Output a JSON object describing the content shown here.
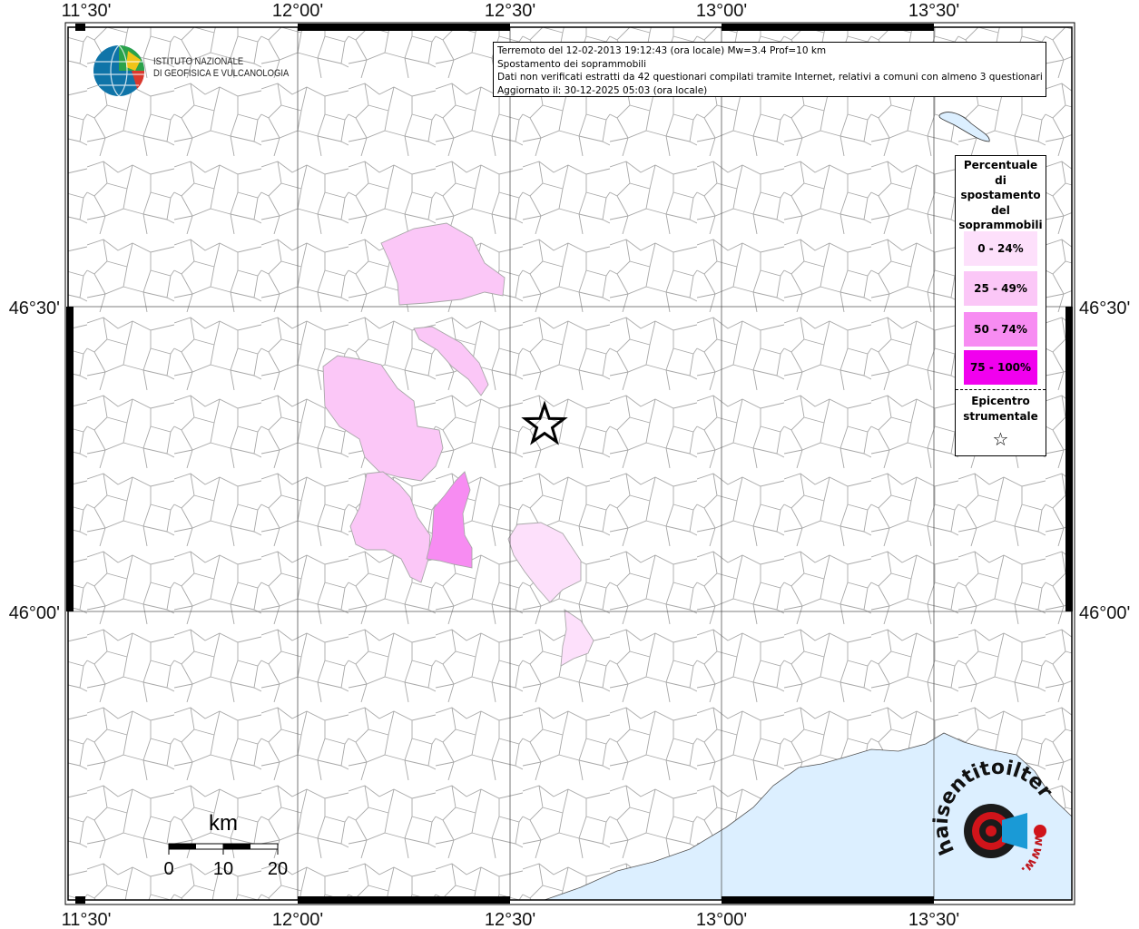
{
  "map": {
    "title_lines": [
      "Terremoto del 12-02-2013 19:12:43 (ora locale) Mw=3.4 Prof=10 km",
      "Spostamento dei soprammobili",
      "Dati non verificati estratti da 42 questionari compilati tramite Internet, relativi a comuni con almeno 3 questionari.",
      "Aggiornato il: 30-12-2025 05:03 (ora locale)"
    ],
    "lon_labels": [
      "11°30'",
      "12°00'",
      "12°30'",
      "13°00'",
      "13°30'"
    ],
    "lat_labels": [
      "46°30'",
      "46°00'"
    ],
    "colors": {
      "sea": "#dcefff",
      "border": "#a8a8a8",
      "frame": "#000000",
      "class_0_24": "#fde0fb",
      "class_25_49": "#fbc7f7",
      "class_50_74": "#f78cf2",
      "class_75_100": "#f100ee"
    }
  },
  "legend": {
    "title": [
      "Percentuale",
      "di",
      "spostamento",
      "del",
      "soprammobili"
    ],
    "classes": [
      "0 - 24%",
      "25 - 49%",
      "50 - 74%",
      "75 - 100%"
    ],
    "epicenter_label": [
      "Epicentro",
      "strumentale"
    ],
    "epicenter_icon": "star-outline-icon"
  },
  "logo": {
    "ingv_lines": [
      "ISTITUTO NAZIONALE",
      "DI GEOFISICA E VULCANOLOGIA"
    ],
    "hsit_text": "haisentitoilterremoto.it",
    "hsit_www": "www."
  },
  "scalebar": {
    "unit": "km",
    "ticks": [
      "0",
      "10",
      "20"
    ]
  }
}
